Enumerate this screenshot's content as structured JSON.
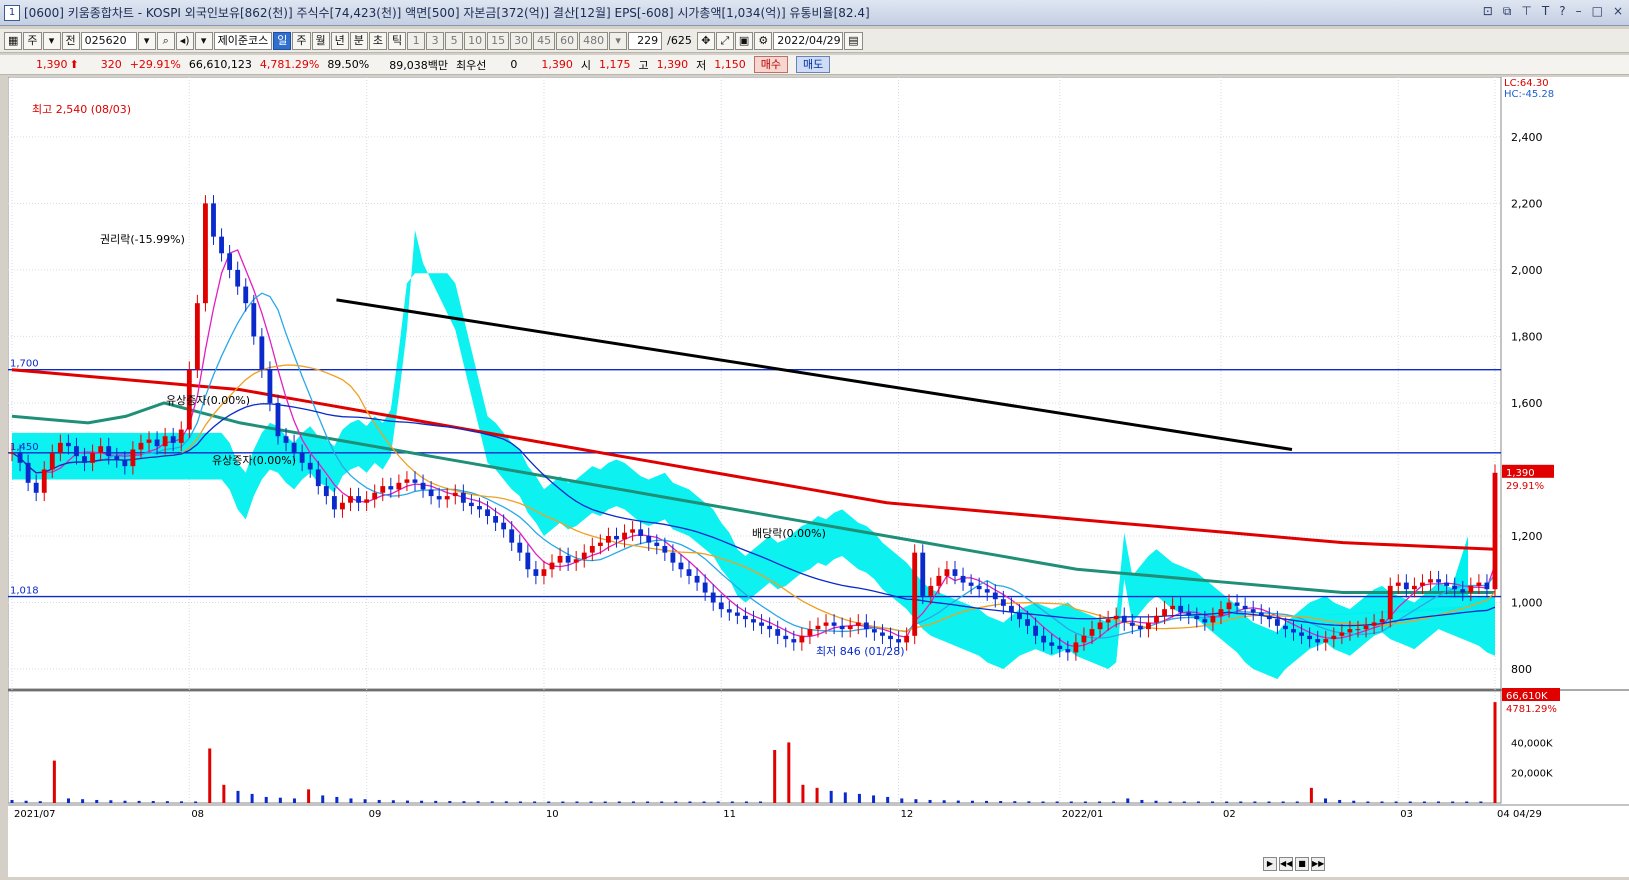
{
  "window": {
    "number": "1",
    "title": "[0600] 키움종합차트 - KOSPI 외국인보유[862(천)] 주식수[74,423(천)] 액면[500] 자본금[372(억)] 결산[12월] EPS[-608] 시가총액[1,034(억)] 유통비율[82.4]"
  },
  "toolbar": {
    "market": "주",
    "jeon": "전",
    "code": "025620",
    "stock_name": "제이준코스",
    "periods": [
      "일",
      "주",
      "월",
      "년",
      "분",
      "초",
      "틱"
    ],
    "selected_period": "일",
    "minute_opts": [
      "1",
      "3",
      "5",
      "10",
      "15",
      "30",
      "45",
      "60",
      "480"
    ],
    "count": "229",
    "count_total": "/625",
    "date": "2022/04/29"
  },
  "quote": {
    "price": "1,390",
    "change": "320",
    "change_pct": "+29.91%",
    "volume": "66,610,123",
    "volume_pct": "4,781.29%",
    "ratio": "89.50%",
    "amount": "89,038백만",
    "best_label": "최우선",
    "best_val": "0",
    "price2": "1,390",
    "open_label": "시",
    "open": "1,175",
    "high_label": "고",
    "high": "1,390",
    "low_label": "저",
    "low": "1,150",
    "buy": "매수",
    "sell": "매도"
  },
  "chart_data": {
    "type": "line",
    "scale": {
      "lc": "LC:64.30",
      "hc": "HC:-45.28"
    },
    "y_ticks": [
      "2,400",
      "2,200",
      "2,000",
      "1,800",
      "1,600",
      "1,200",
      "1,000",
      "800"
    ],
    "y_tick_values": [
      2400,
      2200,
      2000,
      1800,
      1600,
      1200,
      1000,
      800
    ],
    "ylim": [
      740,
      2580
    ],
    "h_lines": [
      {
        "label": "1,700",
        "value": 1700
      },
      {
        "label": "1,450",
        "value": 1450
      },
      {
        "label": "1,018",
        "value": 1018
      }
    ],
    "last_price_label": "1,390",
    "last_pct_label": "29.91%",
    "annotations": {
      "high": "최고 2,540 (08/03)",
      "low": "최저 846 (01/28)",
      "rights": "권리락(-15.99%)",
      "paid1": "유상증자(0.00%)",
      "paid2": "유상증자(0.00%)",
      "bonus": "배당락(0.00%)"
    },
    "x_labels": [
      "2021/07",
      "08",
      "09",
      "10",
      "11",
      "12",
      "2022/01",
      "02",
      "03",
      "04",
      "04/29"
    ],
    "close": [
      1450,
      1420,
      1360,
      1330,
      1400,
      1450,
      1480,
      1470,
      1440,
      1420,
      1450,
      1470,
      1440,
      1430,
      1410,
      1460,
      1480,
      1490,
      1470,
      1500,
      1480,
      1520,
      1700,
      1900,
      2200,
      2100,
      2050,
      2000,
      1950,
      1900,
      1800,
      1700,
      1600,
      1500,
      1480,
      1450,
      1420,
      1400,
      1350,
      1320,
      1280,
      1300,
      1320,
      1300,
      1310,
      1330,
      1350,
      1340,
      1360,
      1370,
      1360,
      1340,
      1320,
      1310,
      1320,
      1330,
      1300,
      1290,
      1280,
      1260,
      1240,
      1220,
      1180,
      1150,
      1100,
      1080,
      1100,
      1120,
      1140,
      1120,
      1130,
      1150,
      1170,
      1180,
      1200,
      1190,
      1210,
      1220,
      1200,
      1180,
      1170,
      1150,
      1120,
      1100,
      1080,
      1060,
      1030,
      1000,
      980,
      970,
      960,
      950,
      940,
      930,
      920,
      900,
      890,
      880,
      900,
      920,
      930,
      940,
      930,
      920,
      930,
      940,
      920,
      910,
      900,
      890,
      880,
      900,
      1150,
      1020,
      1050,
      1080,
      1100,
      1080,
      1060,
      1050,
      1040,
      1030,
      1010,
      990,
      970,
      950,
      930,
      900,
      880,
      870,
      860,
      850,
      880,
      900,
      920,
      940,
      950,
      960,
      940,
      930,
      920,
      940,
      960,
      980,
      990,
      970,
      960,
      950,
      940,
      960,
      980,
      1000,
      990,
      980,
      970,
      960,
      950,
      930,
      920,
      910,
      900,
      890,
      880,
      890,
      900,
      910,
      920,
      920,
      930,
      940,
      950,
      1050,
      1060,
      1040,
      1050,
      1060,
      1070,
      1060,
      1050,
      1040,
      1030,
      1050,
      1060,
      1040,
      1390
    ],
    "ma_long": [
      1700,
      1690,
      1680,
      1670,
      1660,
      1650,
      1640,
      1620,
      1600,
      1580,
      1560,
      1540,
      1520,
      1500,
      1480,
      1460,
      1440,
      1420,
      1400,
      1380,
      1360,
      1340,
      1320,
      1300,
      1290,
      1280,
      1270,
      1260,
      1250,
      1240,
      1230,
      1220,
      1210,
      1200,
      1190,
      1180,
      1175,
      1170,
      1165,
      1160
    ],
    "ma_mid": [
      1560,
      1550,
      1540,
      1560,
      1600,
      1570,
      1540,
      1520,
      1500,
      1480,
      1460,
      1440,
      1420,
      1400,
      1380,
      1360,
      1340,
      1320,
      1300,
      1280,
      1260,
      1240,
      1220,
      1200,
      1180,
      1160,
      1140,
      1120,
      1100,
      1090,
      1080,
      1070,
      1060,
      1050,
      1040,
      1030,
      1030,
      1030,
      1030,
      1030
    ],
    "trend": [
      [
        0.22,
        1910
      ],
      [
        0.86,
        1460
      ]
    ],
    "volume_ticks": [
      "40,000K",
      "20,000K"
    ],
    "volume_tick_values": [
      40000,
      20000
    ],
    "volume_max_label": "66,610K",
    "volume_pct_label": "4781.29%",
    "volume": [
      2000,
      1500,
      1200,
      28000,
      3000,
      2500,
      2000,
      1800,
      1500,
      1400,
      1300,
      1200,
      1100,
      1000,
      36000,
      12000,
      8000,
      6000,
      4000,
      3500,
      3000,
      9000,
      5000,
      4000,
      3000,
      2500,
      2000,
      1800,
      1600,
      1500,
      1400,
      1300,
      1200,
      1200,
      1100,
      1100,
      1000,
      1000,
      1000,
      1000,
      1000,
      1000,
      1000,
      1000,
      1000,
      1000,
      1000,
      1000,
      1000,
      1000,
      1000,
      1000,
      1000,
      1000,
      35000,
      40000,
      12000,
      10000,
      8000,
      7000,
      6000,
      5000,
      4000,
      3000,
      2500,
      2000,
      1800,
      1600,
      1500,
      1400,
      1300,
      1200,
      1100,
      1000,
      1000,
      1000,
      1000,
      1000,
      1000,
      3000,
      2000,
      1500,
      1000,
      1000,
      1000,
      1000,
      1000,
      1000,
      1000,
      1000,
      1000,
      1000,
      10000,
      3000,
      2000,
      1500,
      1000,
      1000,
      1000,
      1000,
      1000,
      1000,
      1000,
      1000,
      1000,
      66610
    ]
  },
  "colors": {
    "red": "#e00000",
    "blue": "#0a2acb",
    "cyan": "#00f0f0",
    "teal": "#1f8f78",
    "black": "#000000",
    "magenta": "#e020c0",
    "orange": "#f0a020",
    "skyblue": "#2aa8e8"
  }
}
